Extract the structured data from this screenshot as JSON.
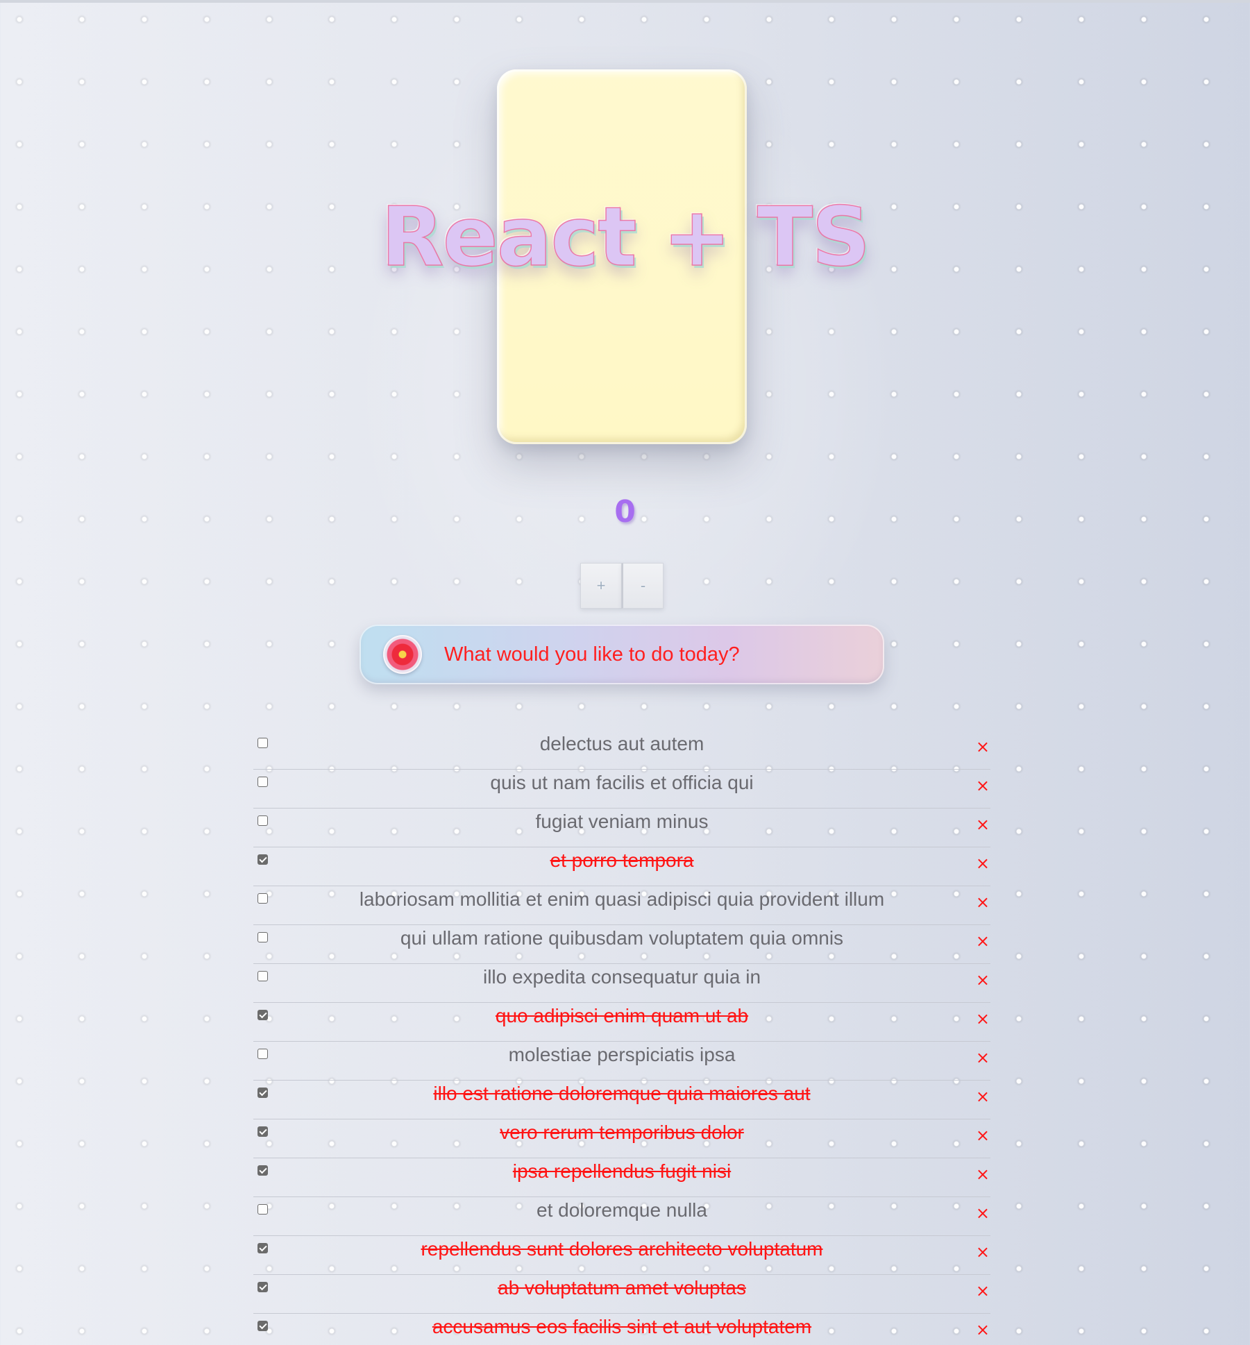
{
  "hero": {
    "title": "React + TS"
  },
  "counter": {
    "value": "0"
  },
  "controls": {
    "increment_label": "+",
    "decrement_label": "-"
  },
  "search": {
    "placeholder": "What would you like to do today?",
    "value": ""
  },
  "todos": [
    {
      "text": "delectus aut autem",
      "done": false
    },
    {
      "text": "quis ut nam facilis et officia qui",
      "done": false
    },
    {
      "text": "fugiat veniam minus",
      "done": false
    },
    {
      "text": "et porro tempora",
      "done": true
    },
    {
      "text": "laboriosam mollitia et enim quasi adipisci quia provident illum",
      "done": false
    },
    {
      "text": "qui ullam ratione quibusdam voluptatem quia omnis",
      "done": false
    },
    {
      "text": "illo expedita consequatur quia in",
      "done": false
    },
    {
      "text": "quo adipisci enim quam ut ab",
      "done": true
    },
    {
      "text": "molestiae perspiciatis ipsa",
      "done": false
    },
    {
      "text": "illo est ratione doloremque quia maiores aut",
      "done": true
    },
    {
      "text": "vero rerum temporibus dolor",
      "done": true
    },
    {
      "text": "ipsa repellendus fugit nisi",
      "done": true
    },
    {
      "text": "et doloremque nulla",
      "done": false
    },
    {
      "text": "repellendus sunt dolores architecto voluptatum",
      "done": true
    },
    {
      "text": "ab voluptatum amet voluptas",
      "done": true
    },
    {
      "text": "accusamus eos facilis sint et aut voluptatem",
      "done": true
    }
  ],
  "remove_glyph": "×",
  "colors": {
    "card": "#fff8c6",
    "accent_purple": "#a76ef0",
    "done_red": "#ff1414",
    "text_gray": "#6a6a70"
  }
}
